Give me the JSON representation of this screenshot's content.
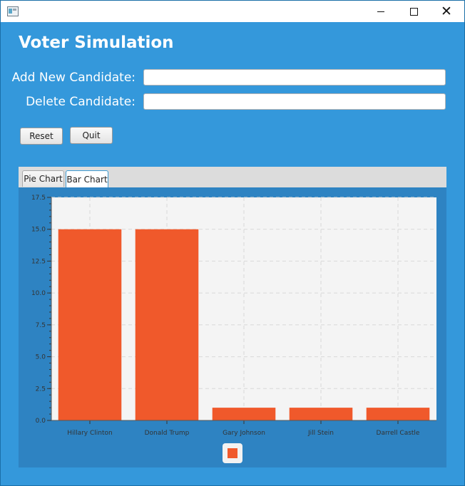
{
  "window": {
    "controls": [
      "minimize",
      "maximize",
      "close"
    ],
    "close_glyph": "✕"
  },
  "app": {
    "title": "Voter Simulation"
  },
  "form": {
    "add_label": "Add New Candidate:",
    "add_value": "",
    "delete_label": "Delete Candidate:",
    "delete_value": ""
  },
  "buttons": {
    "reset": "Reset",
    "quit": "Quit"
  },
  "tabs": [
    {
      "label": "Pie Chart",
      "selected": false
    },
    {
      "label": "Bar Chart",
      "selected": true
    }
  ],
  "colors": {
    "background": "#3498DB",
    "bar": "#F0592B",
    "plot_bg": "#F4F4F4",
    "chart_area": "#2E83C2"
  },
  "chart_data": {
    "type": "bar",
    "categories": [
      "Hillary Clinton",
      "Donald Trump",
      "Gary Johnson",
      "Jill Stein",
      "Darrell Castle"
    ],
    "series": [
      {
        "values": [
          15,
          15,
          1,
          1,
          1
        ]
      }
    ],
    "yticks": [
      "0.0",
      "2.5",
      "5.0",
      "7.5",
      "10.0",
      "12.5",
      "15.0",
      "17.5"
    ],
    "ylim": [
      0,
      17.5
    ],
    "grid": true,
    "legend": "bottom-center"
  }
}
